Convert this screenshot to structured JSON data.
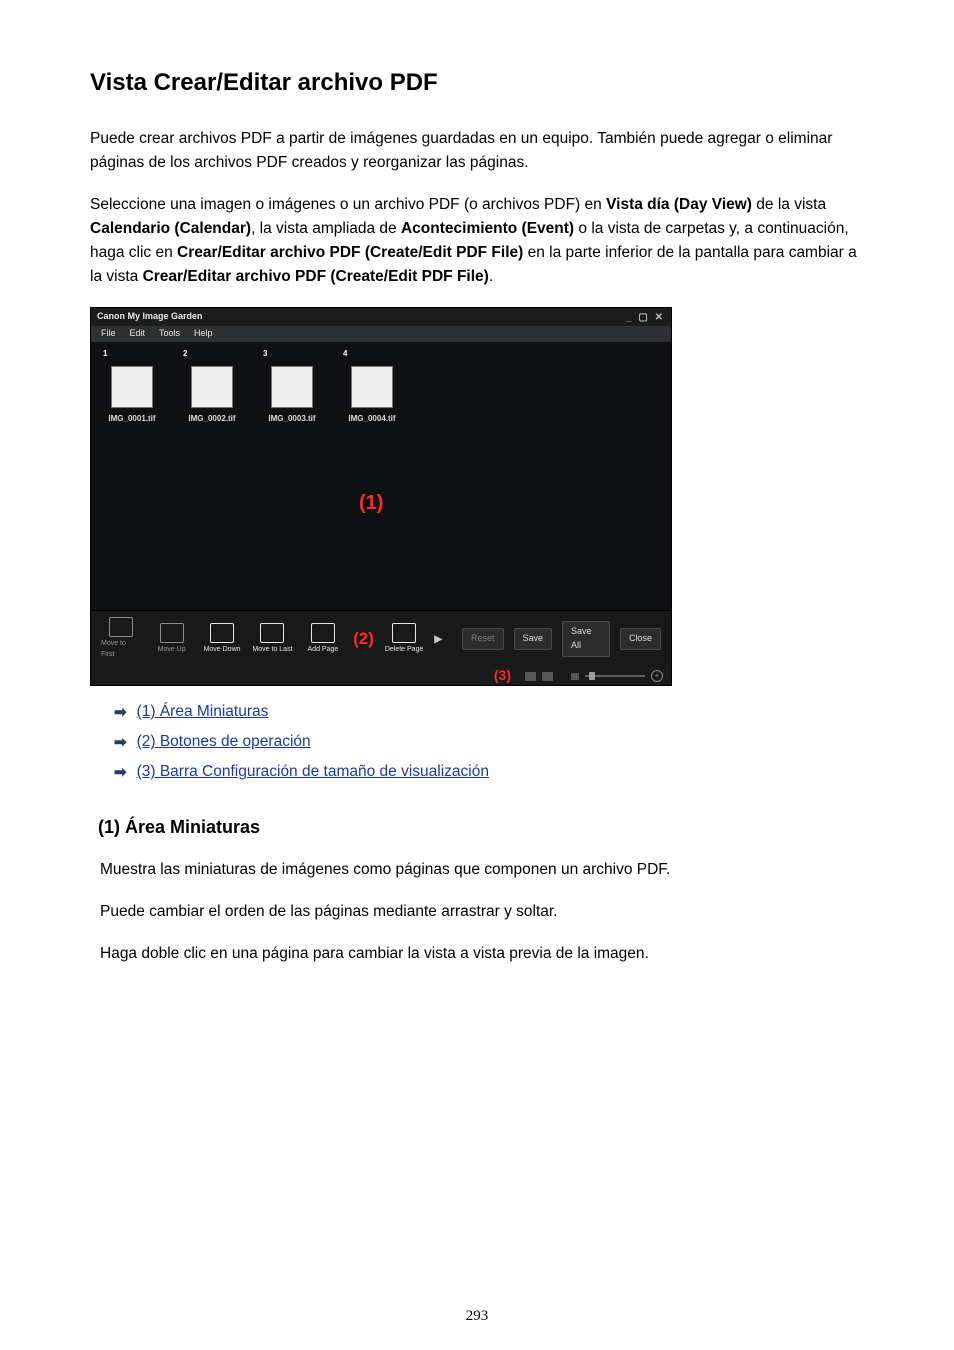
{
  "title": "Vista Crear/Editar archivo PDF",
  "para1": "Puede crear archivos PDF a partir de imágenes guardadas en un equipo. También puede agregar o eliminar páginas de los archivos PDF creados y reorganizar las páginas.",
  "para2": {
    "a": "Seleccione una imagen o imágenes o un archivo PDF (o archivos PDF) en ",
    "b1": "Vista día (Day View)",
    "c": " de la vista ",
    "b2": "Calendario (Calendar)",
    "d": ", la vista ampliada de ",
    "b3": "Acontecimiento (Event)",
    "e": " o la vista de carpetas y, a continuación, haga clic en ",
    "b4": "Crear/Editar archivo PDF (Create/Edit PDF File)",
    "f": " en la parte inferior de la pantalla para cambiar a la vista ",
    "b5": "Crear/Editar archivo PDF (Create/Edit PDF File)",
    "g": "."
  },
  "screenshot": {
    "title": "Canon My Image Garden",
    "menus": [
      "File",
      "Edit",
      "Tools",
      "Help"
    ],
    "thumbs": [
      {
        "n": "1",
        "name": "IMG_0001.tif"
      },
      {
        "n": "2",
        "name": "IMG_0002.tif"
      },
      {
        "n": "3",
        "name": "IMG_0003.tif"
      },
      {
        "n": "4",
        "name": "IMG_0004.tif"
      }
    ],
    "marker1": "(1)",
    "ops": [
      {
        "label": "Move to First",
        "id": "move-first"
      },
      {
        "label": "Move Up",
        "id": "move-up"
      },
      {
        "label": "Move Down",
        "id": "move-down"
      },
      {
        "label": "Move to Last",
        "id": "move-last"
      },
      {
        "label": "Add Page",
        "id": "add-page"
      }
    ],
    "marker2": "(2)",
    "ops_after": [
      {
        "label": "Delete Page",
        "id": "delete-page"
      }
    ],
    "btns": [
      {
        "label": "Reset",
        "ghost": true
      },
      {
        "label": "Save"
      },
      {
        "label": "Save All"
      },
      {
        "label": "Close"
      }
    ],
    "marker3": "(3)"
  },
  "links": [
    "(1) Área Miniaturas",
    "(2) Botones de operación",
    "(3) Barra Configuración de tamaño de visualización"
  ],
  "section1": {
    "heading": "(1) Área Miniaturas",
    "p1": "Muestra las miniaturas de imágenes como páginas que componen un archivo PDF.",
    "p2": "Puede cambiar el orden de las páginas mediante arrastrar y soltar.",
    "p3": "Haga doble clic en una página para cambiar la vista a vista previa de la imagen."
  },
  "page_number": "293"
}
